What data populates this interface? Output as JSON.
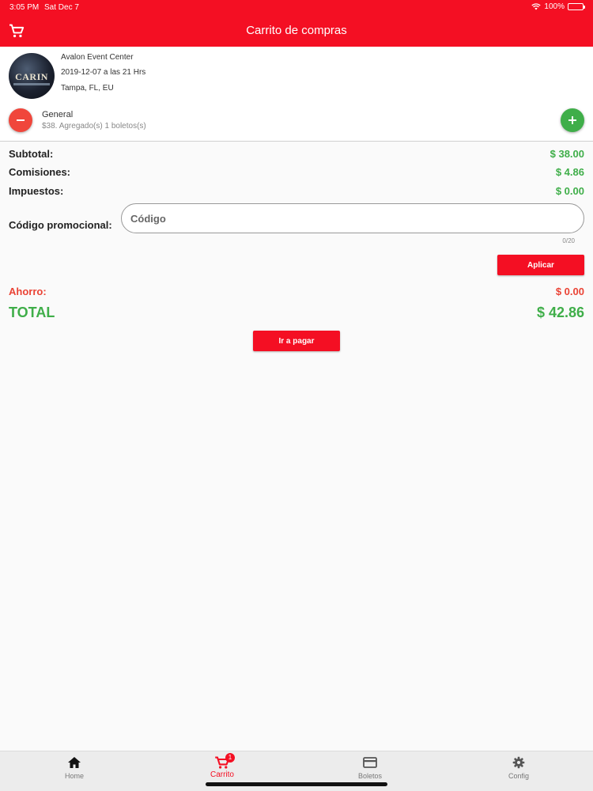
{
  "status": {
    "time": "3:05 PM",
    "date": "Sat Dec 7",
    "battery": "100%",
    "battery_level": 1.0
  },
  "header": {
    "title": "Carrito de compras",
    "cart_icon": "cart-icon"
  },
  "event": {
    "poster_text": "CARIN",
    "venue": "Avalon Event Center",
    "date": "2019-12-07 a las 21 Hrs",
    "city": "Tampa, FL, EU"
  },
  "ticket": {
    "name": "General",
    "info": "$38. Agregado(s) 1 boletos(s)",
    "minus_icon": "minus-icon",
    "plus_icon": "plus-icon"
  },
  "totals": {
    "subtotal_label": "Subtotal:",
    "subtotal_value": "$ 38.00",
    "commissions_label": "Comisiones:",
    "commissions_value": "$ 4.86",
    "taxes_label": "Impuestos:",
    "taxes_value": "$ 0.00",
    "promo_label": "Código promocional:",
    "promo_placeholder": "Código",
    "promo_value": "",
    "promo_counter": "0/20",
    "apply_label": "Aplicar",
    "savings_label": "Ahorro:",
    "savings_value": "$ 0.00",
    "total_label": "TOTAL",
    "total_value": "$ 42.86",
    "pay_label": "Ir a pagar"
  },
  "colors": {
    "brand_red": "#f40f23",
    "green": "#3fae49",
    "savings_red": "#ea4335"
  },
  "tabs": [
    {
      "label": "Home",
      "icon": "home-icon"
    },
    {
      "label": "Carrito",
      "icon": "cart-icon",
      "badge": "1"
    },
    {
      "label": "Boletos",
      "icon": "ticket-card-icon"
    },
    {
      "label": "Config",
      "icon": "gear-icon"
    }
  ],
  "active_tab": "Carrito"
}
